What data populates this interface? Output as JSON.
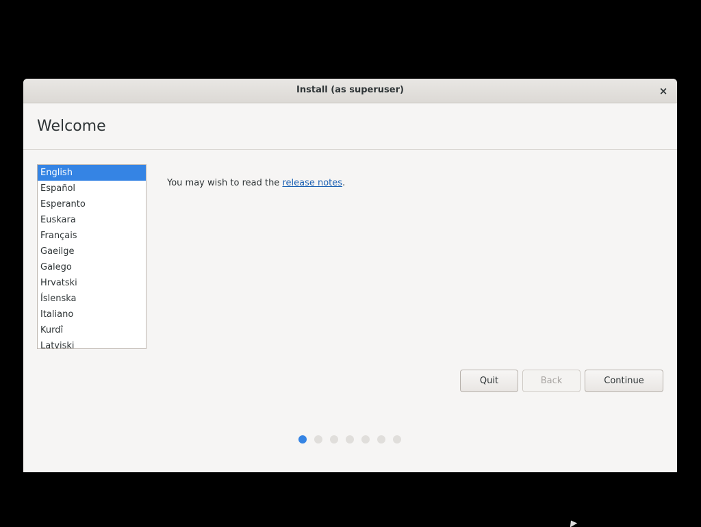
{
  "window": {
    "title": "Install (as superuser)",
    "close_label": "×"
  },
  "header": {
    "title": "Welcome"
  },
  "languages": {
    "items": [
      "English",
      "Español",
      "Esperanto",
      "Euskara",
      "Français",
      "Gaeilge",
      "Galego",
      "Hrvatski",
      "Íslenska",
      "Italiano",
      "Kurdî",
      "Latviski"
    ],
    "selected": "English"
  },
  "release_notes": {
    "prefix": "You may wish to read the ",
    "link": "release notes",
    "suffix": "."
  },
  "buttons": {
    "quit": "Quit",
    "back": "Back",
    "continue": "Continue"
  },
  "progress": {
    "total_steps": 7,
    "current_step": 1
  },
  "colors": {
    "accent": "#3584e4",
    "link": "#1c61b3"
  }
}
